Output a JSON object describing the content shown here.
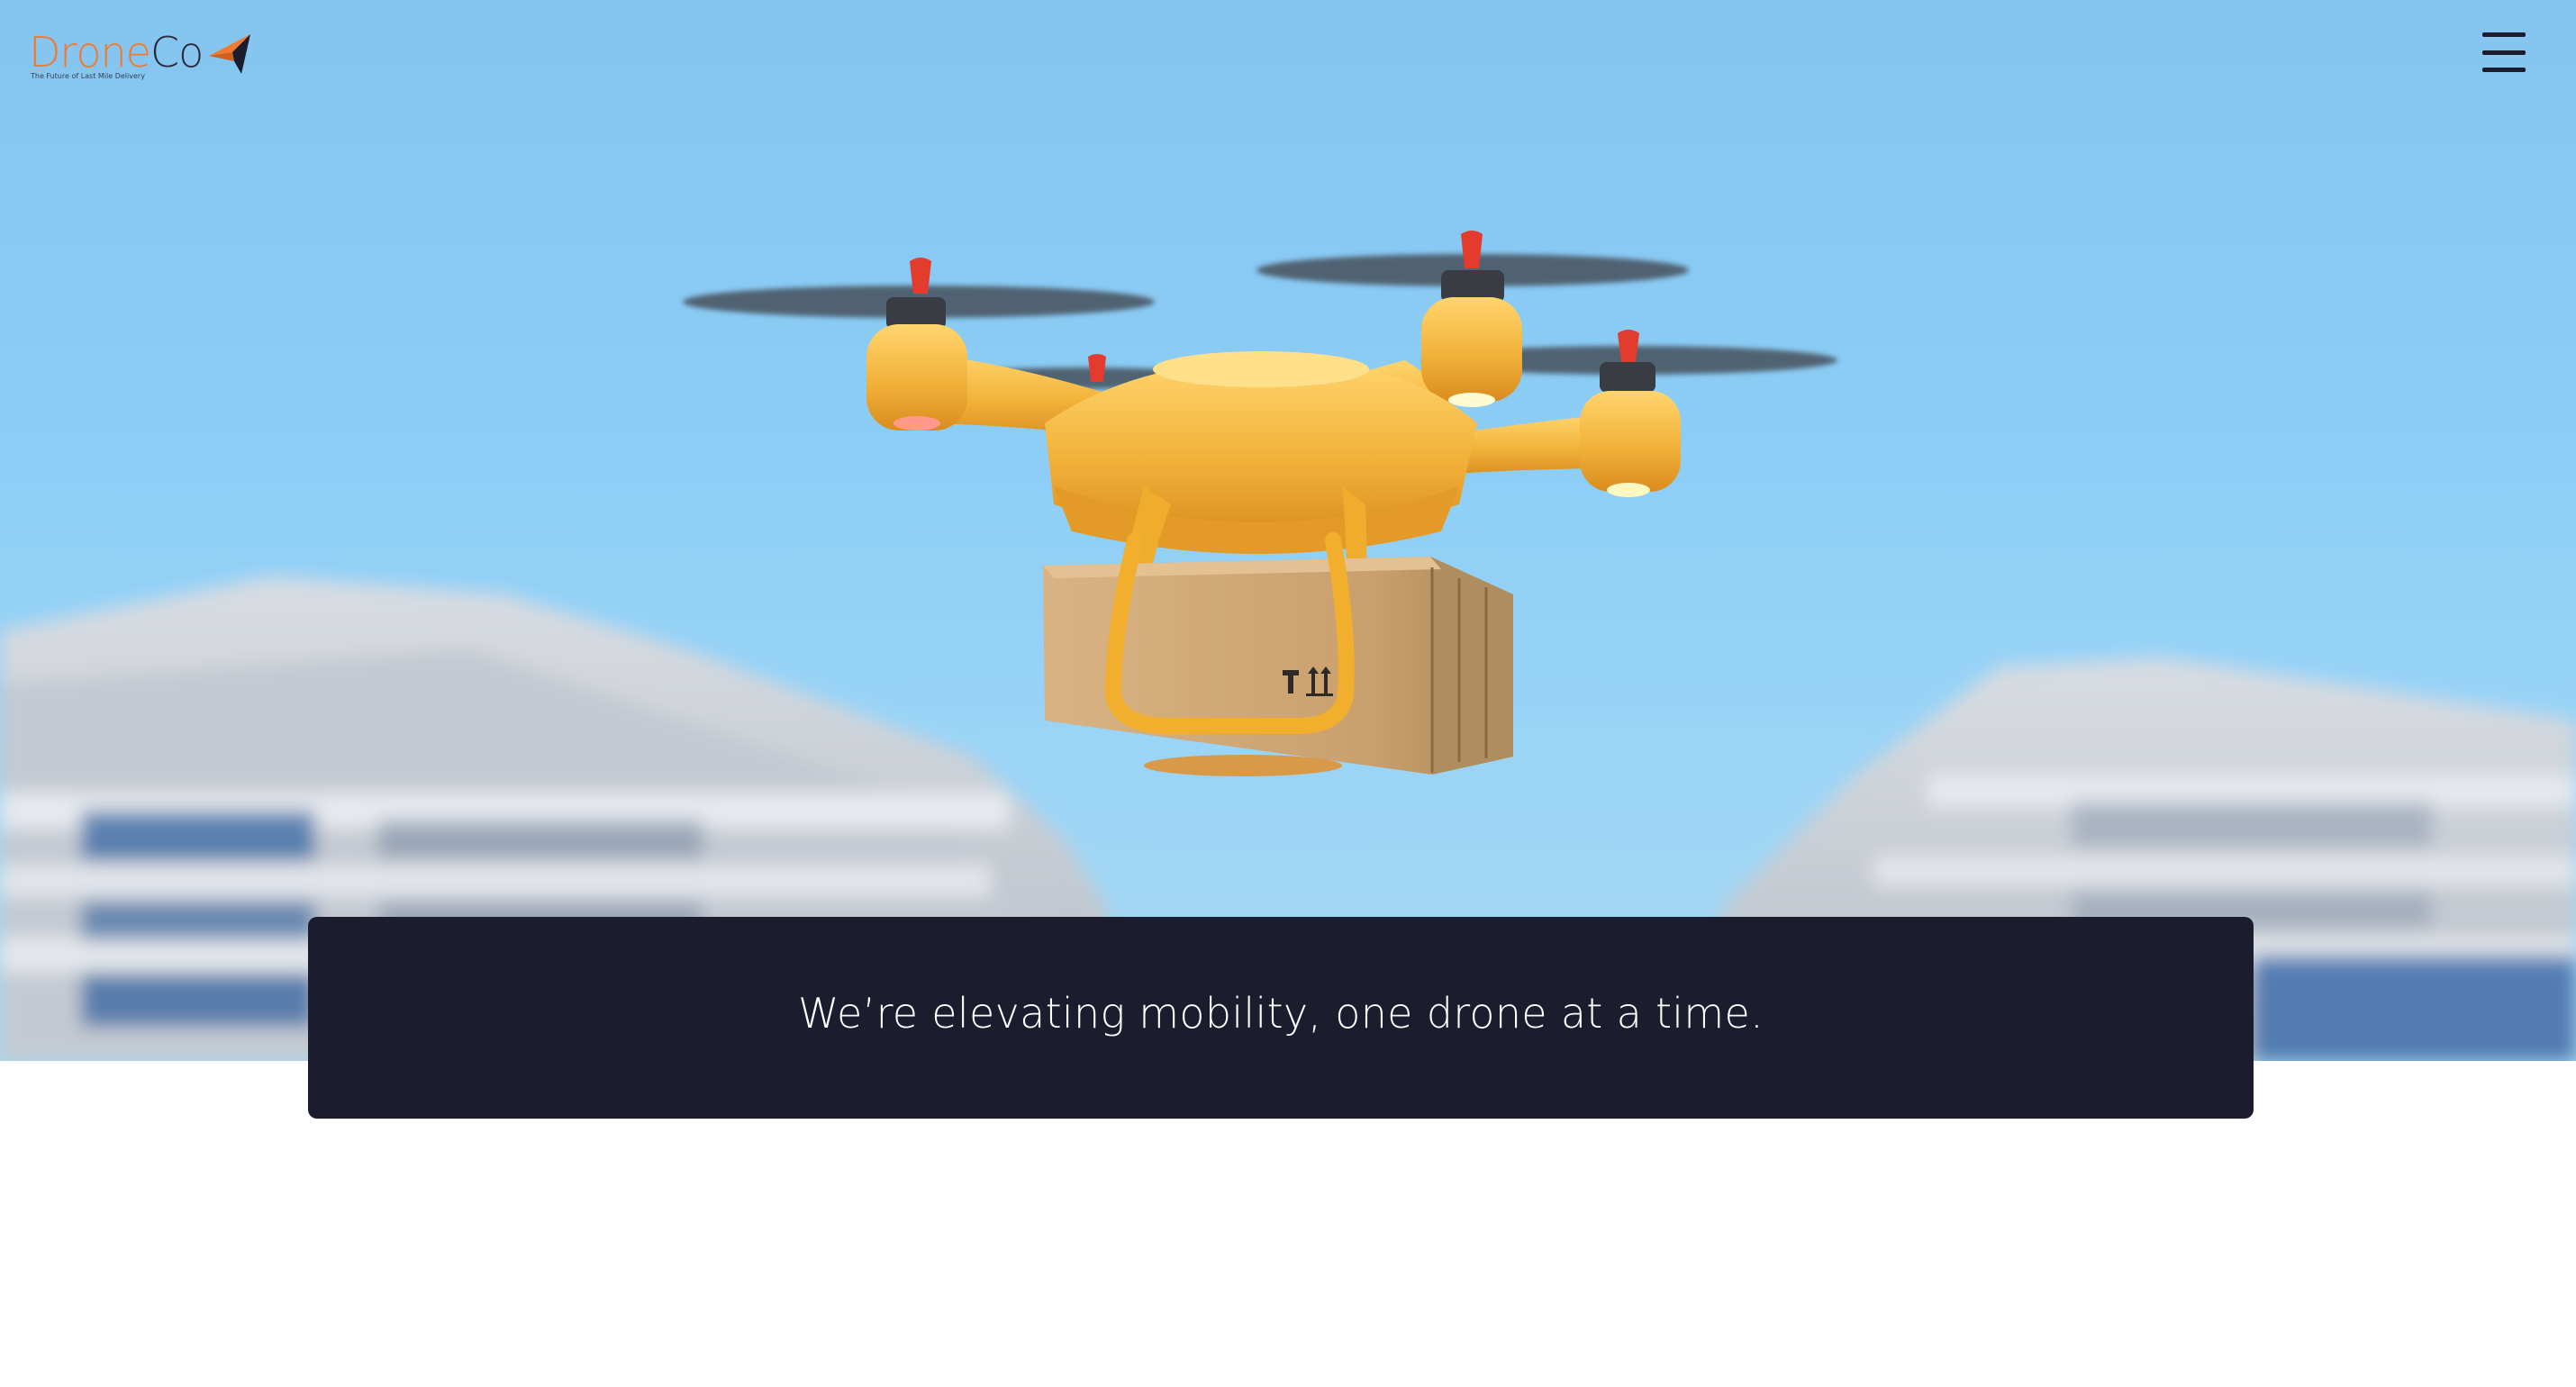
{
  "header": {
    "logo": {
      "text_part1": "Dr",
      "text_part2": "o",
      "text_part3": "ne",
      "text_part4": "Co",
      "tagline": "The Future of Last Mile Delivery",
      "icon": "paper-plane-icon"
    },
    "menu_icon": "hamburger-menu-icon"
  },
  "hero": {
    "image_subject": "drone-delivering-package"
  },
  "banner": {
    "text": "We’re elevating mobility, one drone at a time."
  },
  "colors": {
    "brand_orange": "#f07a2e",
    "brand_navy": "#1b1c2e",
    "sky": "#8ccdf6",
    "drone_yellow": "#f2b63c"
  }
}
